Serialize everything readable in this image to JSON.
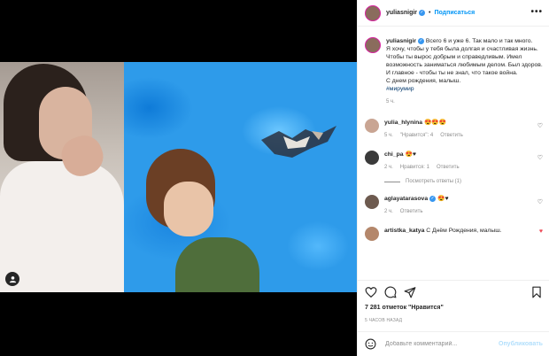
{
  "header": {
    "username": "yuliasnigir",
    "follow_label": "Подписаться",
    "more_label": "•••"
  },
  "caption": {
    "username": "yuliasnigir",
    "lines": [
      "Всего 6 и уже 6. Так мало и так много.",
      "Я хочу, чтобы у тебя была долгая и счастливая жизнь. Чтобы ты вырос добрым и справедливым. Имел возможность заниматься любимым делом. Был здоров.",
      "И главное - чтобы ты не знал, что такое война.",
      "С днем рождения, малыш."
    ],
    "hashtag": "#мирумир",
    "time": "5 ч."
  },
  "comments": [
    {
      "username": "yulia_hlynina",
      "text": "😍😍😍",
      "time": "5 ч.",
      "likes_label": "\"Нравится\": 4",
      "reply_label": "Ответить",
      "liked": false
    },
    {
      "username": "chi_pa",
      "text": "😍♥",
      "time": "2 ч.",
      "likes_label": "Нравится: 1",
      "reply_label": "Ответить",
      "liked": false,
      "replies_label": "Посмотреть ответы (1)"
    },
    {
      "username": "aglayatarasova",
      "text": "😍♥",
      "time": "2 ч.",
      "likes_label": "",
      "reply_label": "Ответить",
      "liked": false
    },
    {
      "username": "artistka_katya",
      "text": "С Днём Рождения, малыш.",
      "time": "",
      "likes_label": "",
      "reply_label": "",
      "liked": true
    }
  ],
  "stats": {
    "likes": "7 281 отметок \"Нравится\"",
    "ago": "5 ЧАСОВ НАЗАД"
  },
  "composer": {
    "placeholder": "Добавьте комментарий...",
    "post_label": "Опубликовать"
  },
  "icons": [
    "heart-icon",
    "comment-icon",
    "share-icon",
    "bookmark-icon",
    "emoji-icon",
    "tag-user-icon",
    "verified-icon",
    "more-icon"
  ],
  "colors": {
    "link": "#0095f6",
    "verified": "#3897f0",
    "like": "#ed4956",
    "hashtag": "#00376b"
  }
}
